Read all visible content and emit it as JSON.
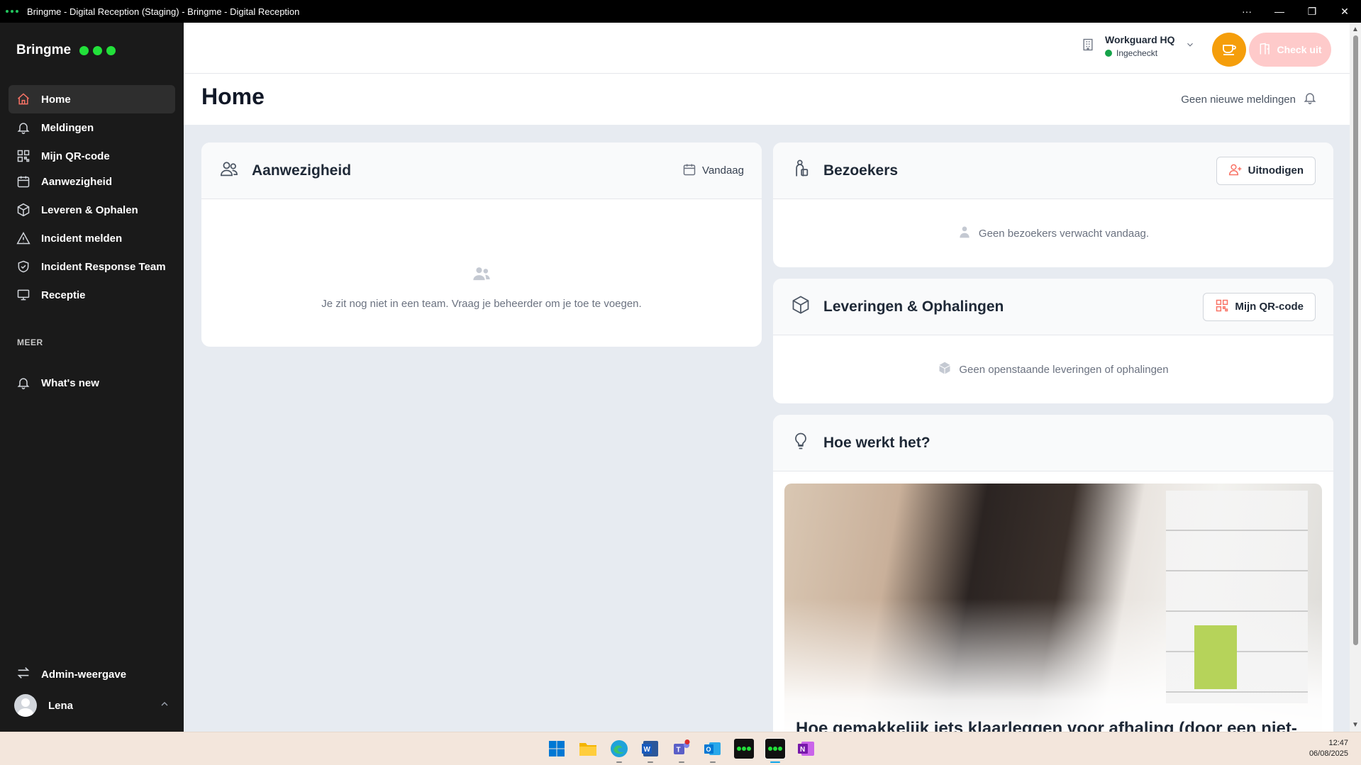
{
  "window": {
    "title": "Bringme - Digital Reception (Staging) - Bringme - Digital Reception",
    "controls": [
      "more",
      "minimize",
      "restore",
      "close"
    ]
  },
  "sidebar": {
    "brand": "Bringme",
    "items": [
      {
        "label": "Home",
        "icon": "home-icon",
        "active": true
      },
      {
        "label": "Meldingen",
        "icon": "bell-icon"
      },
      {
        "label": "Mijn QR-code",
        "icon": "qr-icon"
      },
      {
        "label": "Aanwezigheid",
        "icon": "calendar-icon"
      },
      {
        "label": "Leveren & Ophalen",
        "icon": "box-icon"
      },
      {
        "label": "Incident melden",
        "icon": "warning-icon"
      },
      {
        "label": "Incident Response Team",
        "icon": "shield-icon"
      },
      {
        "label": "Receptie",
        "icon": "desk-icon"
      }
    ],
    "section_more": "MEER",
    "more_items": [
      {
        "label": "What's new",
        "icon": "bell-icon"
      }
    ],
    "admin_view": "Admin-weergave",
    "user_name": "Lena"
  },
  "topbar": {
    "location_name": "Workguard HQ",
    "location_status": "Ingecheckt",
    "checkout_label": "Check uit"
  },
  "page": {
    "title": "Home",
    "notifications": "Geen nieuwe meldingen"
  },
  "attendance": {
    "title": "Aanwezigheid",
    "date_filter": "Vandaag",
    "empty": "Je zit nog niet in een team. Vraag je beheerder om je toe te voegen."
  },
  "visitors": {
    "title": "Bezoekers",
    "invite_label": "Uitnodigen",
    "empty": "Geen bezoekers verwacht vandaag."
  },
  "deliveries": {
    "title": "Leveringen & Ophalingen",
    "qr_label": "Mijn QR-code",
    "empty": "Geen openstaande leveringen of ophalingen"
  },
  "howto": {
    "title": "Hoe werkt het?",
    "article_title": "Hoe gemakkelijk iets klaarleggen voor afhaling (door een niet-"
  },
  "taskbar": {
    "time": "12:47",
    "date": "06/08/2025"
  },
  "colors": {
    "accent": "#f97366",
    "brand_green": "#22e03a",
    "coffee": "#f59e0b",
    "checkout": "#fecaca",
    "status_green": "#16a34a"
  }
}
